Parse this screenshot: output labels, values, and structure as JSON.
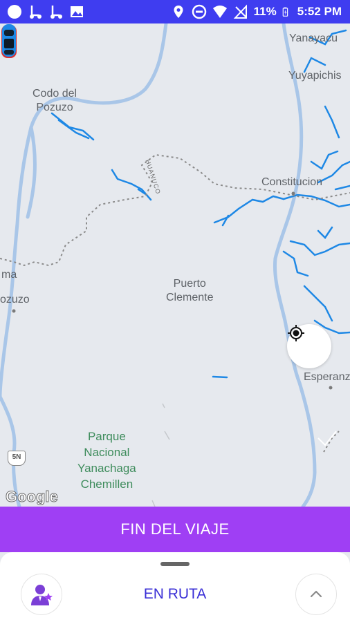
{
  "status_bar": {
    "battery_percent": "11%",
    "time": "5:52 PM",
    "left_icons": [
      "circle-icon",
      "scooter-icon",
      "scooter-icon",
      "image-icon"
    ],
    "right_icons": [
      "location-pin-icon",
      "do-not-disturb-icon",
      "wifi-icon",
      "no-signal-icon",
      "battery-charging-icon"
    ]
  },
  "map": {
    "places": [
      {
        "name": "Yanayacu"
      },
      {
        "name": "Yuyapichis"
      },
      {
        "name": "Codo del\nPozuzo"
      },
      {
        "name": "Constitucion"
      },
      {
        "name": "ma"
      },
      {
        "name": "ozuzo"
      },
      {
        "name": "Puerto\nClemente"
      },
      {
        "name": "Esperanz"
      }
    ],
    "park": "Parque\nNacional\nYanachaga\nChemillen",
    "road_label": "HUANUCO",
    "route_shield": "5N",
    "attribution": "Google",
    "vehicle_icon": "car-icon",
    "locate_icon": "my-location-icon"
  },
  "actions": {
    "end_trip_label": "FIN DEL VIAJE"
  },
  "bottom_sheet": {
    "status": "EN RUTA",
    "left_icon": "driver-avatar-icon",
    "right_icon": "chevron-up-icon"
  },
  "colors": {
    "status_bar": "#3f3df0",
    "end_trip_button": "#9f3ff4",
    "status_text": "#3a2fd6",
    "river": "#1e88e5",
    "map_background": "#e6e9ee"
  }
}
